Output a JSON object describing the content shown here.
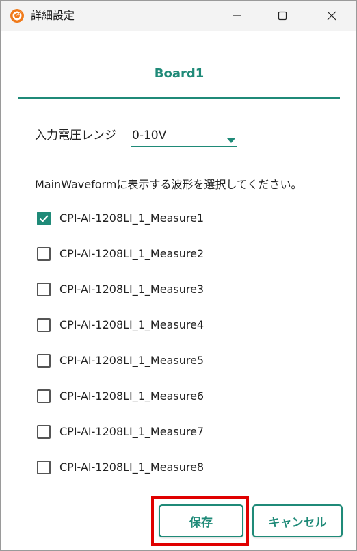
{
  "window": {
    "title": "詳細設定",
    "app_icon": "target-icon"
  },
  "tab": {
    "label": "Board1"
  },
  "input_range": {
    "label": "入力電圧レンジ",
    "selected": "0-10V"
  },
  "instruction": "MainWaveformに表示する波形を選択してください。",
  "channels": [
    {
      "label": "CPI-AI-1208LI_1_Measure1",
      "checked": true
    },
    {
      "label": "CPI-AI-1208LI_1_Measure2",
      "checked": false
    },
    {
      "label": "CPI-AI-1208LI_1_Measure3",
      "checked": false
    },
    {
      "label": "CPI-AI-1208LI_1_Measure4",
      "checked": false
    },
    {
      "label": "CPI-AI-1208LI_1_Measure5",
      "checked": false
    },
    {
      "label": "CPI-AI-1208LI_1_Measure6",
      "checked": false
    },
    {
      "label": "CPI-AI-1208LI_1_Measure7",
      "checked": false
    },
    {
      "label": "CPI-AI-1208LI_1_Measure8",
      "checked": false
    }
  ],
  "buttons": {
    "save": "保存",
    "cancel": "キャンセル"
  },
  "colors": {
    "accent": "#1f8a78",
    "highlight": "#e00000",
    "icon_orange": "#f07a1a"
  }
}
